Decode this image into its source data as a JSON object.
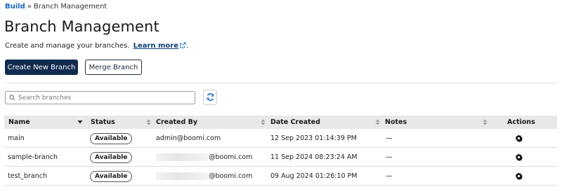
{
  "breadcrumb": {
    "parent": "Build",
    "separator": "»",
    "current": "Branch Management"
  },
  "header": {
    "title": "Branch Management",
    "subtitle": "Create and manage your branches.",
    "learn_more": "Learn more",
    "period": "."
  },
  "toolbar": {
    "create_label": "Create New Branch",
    "merge_label": "Merge Branch"
  },
  "search": {
    "placeholder": "Search branches",
    "value": ""
  },
  "table": {
    "columns": [
      "Name",
      "Status",
      "Created By",
      "Date Created",
      "Notes",
      "Actions"
    ],
    "rows": [
      {
        "name": "main",
        "status": "Available",
        "created_by": "admin@boomi.com",
        "date_created": "12 Sep 2023 01:14:39 PM",
        "notes": "—"
      },
      {
        "name": "sample-branch",
        "status": "Available",
        "created_by": "@boomi.com",
        "date_created": "11 Sep 2024 08:23:24 AM",
        "notes": "—"
      },
      {
        "name": "test_branch",
        "status": "Available",
        "created_by": "@boomi.com",
        "date_created": "09 Aug 2024 01:26:10 PM",
        "notes": "—"
      }
    ]
  },
  "icons": {
    "search": "search-icon",
    "refresh": "refresh-icon",
    "external_link": "external-link-icon",
    "settings": "gear-icon",
    "sort": "sort-icon"
  },
  "colors": {
    "primary_button": "#0f2b4f",
    "link": "#1565c0",
    "refresh_icon": "#1e6fd9",
    "header_bg": "#e8e8e8"
  }
}
